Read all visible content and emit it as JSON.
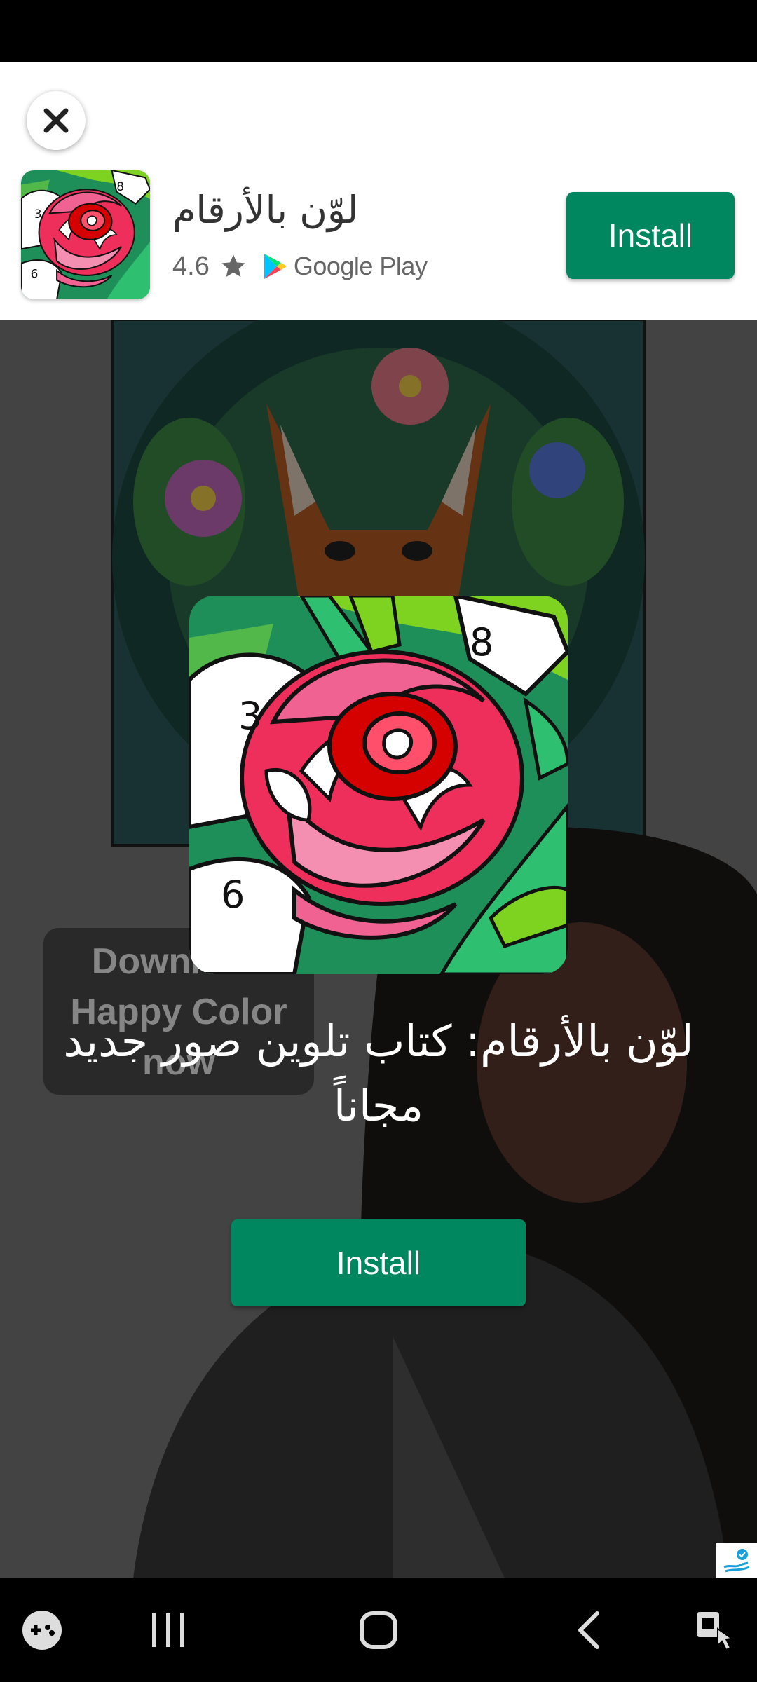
{
  "banner": {
    "app_name": "لوّن بالأرقام",
    "rating": "4.6",
    "store": "Google Play",
    "install_label": "Install",
    "icon_numbers": [
      "3",
      "8",
      "6"
    ]
  },
  "video": {
    "overlay_line1": "Download",
    "overlay_line2": "Happy Color",
    "overlay_line3": "now"
  },
  "main": {
    "headline": "لوّن بالأرقام: كتاب تلوين صور جديد مجاناً",
    "install_label": "Install",
    "icon_numbers": [
      "3",
      "8",
      "6"
    ]
  },
  "colors": {
    "install_green": "#01875f",
    "banner_bg": "#ffffff"
  },
  "nav": {
    "items": [
      "game-launcher-icon",
      "recent-apps-icon",
      "home-icon",
      "back-icon",
      "accessibility-icon"
    ]
  }
}
